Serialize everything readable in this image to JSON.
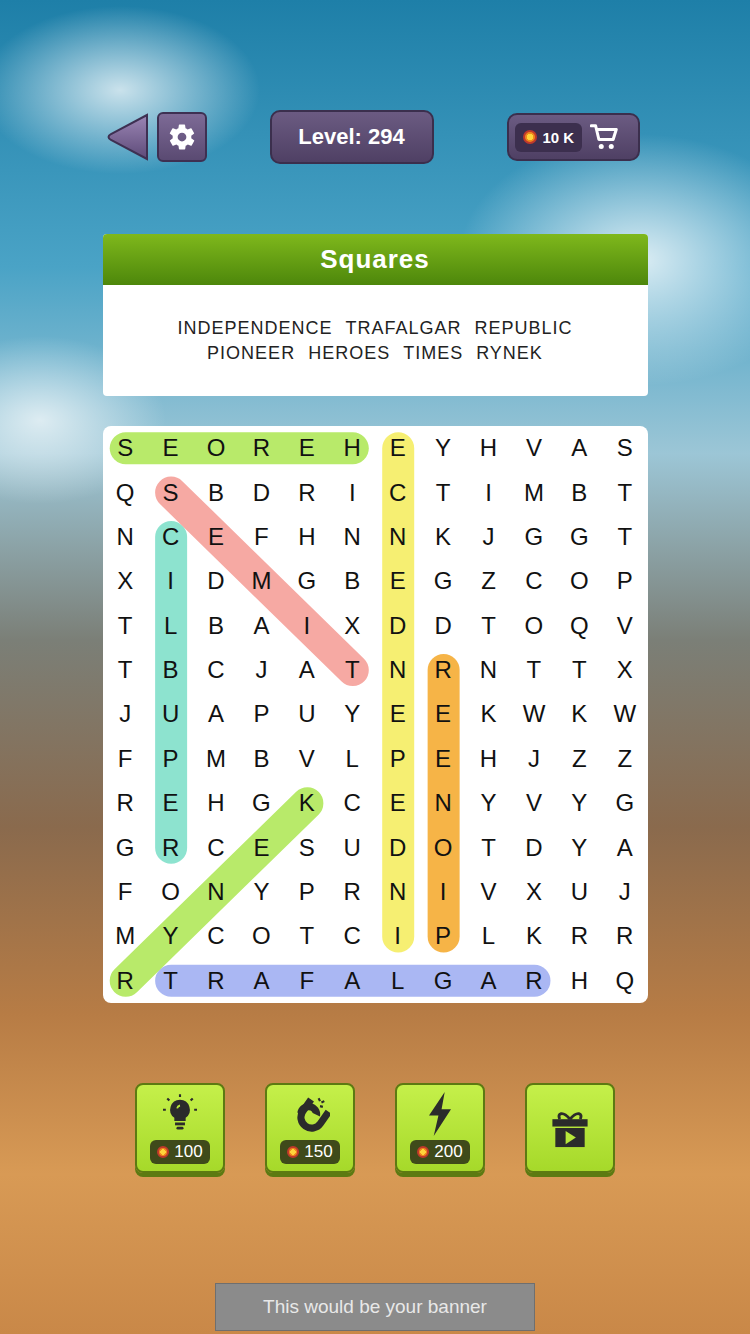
{
  "top_bar": {
    "level_label": "Level: 294",
    "coins": "10 K"
  },
  "puzzle": {
    "title": "Squares",
    "words": [
      {
        "text": "INDEPENDENCE",
        "found": true,
        "color": "#f6ef72"
      },
      {
        "text": "TRAFALGAR",
        "found": true,
        "color": "#aab7f3"
      },
      {
        "text": "REPUBLIC",
        "found": true,
        "color": "#8de3cf"
      },
      {
        "text": "PIONEER",
        "found": true,
        "color": "#f6b447"
      },
      {
        "text": "HEROES",
        "found": true,
        "color": "#b8ea6a"
      },
      {
        "text": "TIMES",
        "found": true,
        "color": "#f6a9a3"
      },
      {
        "text": "RYNEK",
        "found": true,
        "color": "#b8ea6a"
      }
    ]
  },
  "grid": [
    "SEOREHEYHVAS",
    "QSBDRICTIMBT",
    "NCEFHNNKJGGT",
    "XIDMGBEGZCOP",
    "TLBAIXDDTOQV",
    "TBCJATNRNTTX",
    "JUAPUYEEKWKW",
    "FPMBVLPEHJZZ",
    "REHGKCENYVYG",
    "GRCESUDOTDYA",
    "FONYPRNIVXUJ",
    "MYCOTCIPLKRR",
    "RTRAFALGARHQ"
  ],
  "boosters": [
    {
      "kind": "hint",
      "cost": "100"
    },
    {
      "kind": "magnet",
      "cost": "150"
    },
    {
      "kind": "lightning",
      "cost": "200"
    },
    {
      "kind": "gift"
    }
  ],
  "banner": "This would be your banner"
}
